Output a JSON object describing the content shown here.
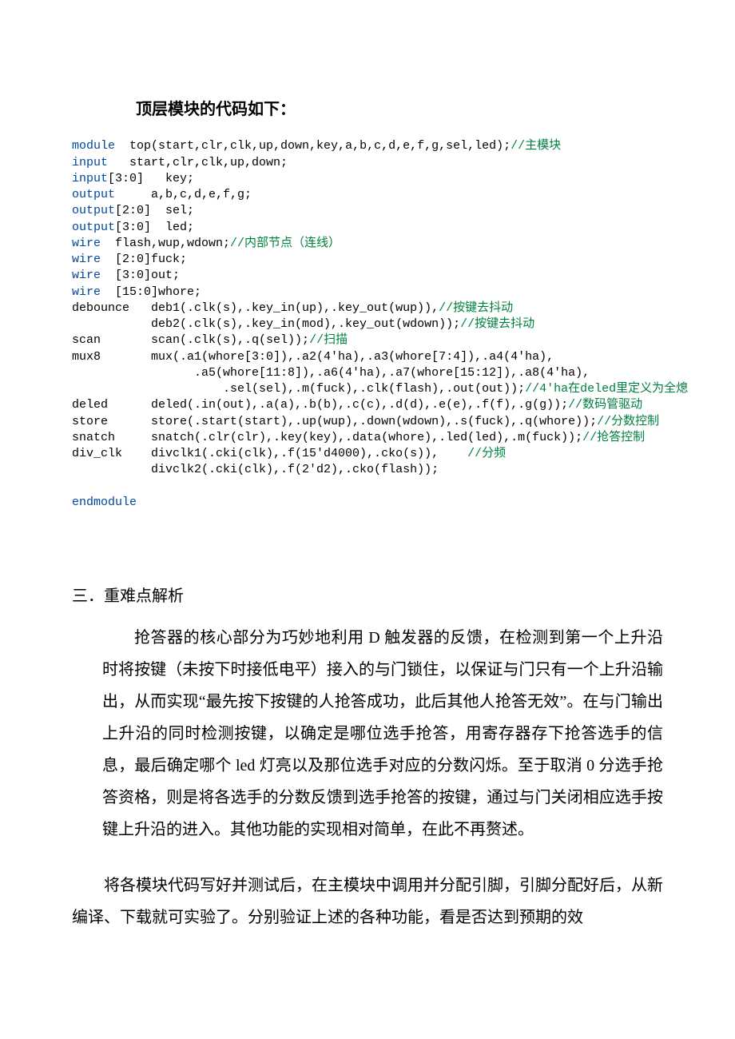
{
  "code_title": "顶层模块的代码如下：",
  "code": {
    "l1a": "module",
    "l1b": "  top(start,clr,clk,up,down,key,a,b,c,d,e,f,g,sel,led);",
    "l1c": "//主模块",
    "l2a": "input",
    "l2b": "   start,clr,clk,up,down;",
    "l3a": "input",
    "l3b": "[3:0]   key;",
    "l4a": "output",
    "l4b": "     a,b,c,d,e,f,g;",
    "l5a": "output",
    "l5b": "[2:0]  sel;",
    "l6a": "output",
    "l6b": "[3:0]  led;",
    "l7a": "wire",
    "l7b": "  flash,wup,wdown;",
    "l7c": "//内部节点（连线）",
    "l8a": "wire",
    "l8b": "  [2:0]fuck;",
    "l9a": "wire",
    "l9b": "  [3:0]out;",
    "l10a": "wire",
    "l10b": "  [15:0]whore;",
    "l11a": "debounce   deb1(.clk(s),.key_in(up),.key_out(wup)),",
    "l11c": "//按键去抖动",
    "l12a": "           deb2(.clk(s),.key_in(mod),.key_out(wdown));",
    "l12c": "//按键去抖动",
    "l13a": "scan       scan(.clk(s),.q(sel));",
    "l13c": "//扫描",
    "l14a": "mux8       mux(.a1(whore[3:0]),.a2(4'ha),.a3(whore[7:4]),.a4(4'ha),",
    "l15a": "                 .a5(whore[11:8]),.a6(4'ha),.a7(whore[15:12]),.a8(4'ha),",
    "l16a": "                     .sel(sel),.m(fuck),.clk(flash),.out(out));",
    "l16c": "//4'ha在deled里定义为全熄",
    "l17a": "deled      deled(.in(out),.a(a),.b(b),.c(c),.d(d),.e(e),.f(f),.g(g));",
    "l17c": "//数码管驱动",
    "l18a": "store      store(.start(start),.up(wup),.down(wdown),.s(fuck),.q(whore));",
    "l18c": "//分数控制",
    "l19a": "snatch     snatch(.clr(clr),.key(key),.data(whore),.led(led),.m(fuck));",
    "l19c": "//抢答控制",
    "l20a": "div_clk    divclk1(.cki(clk),.f(15'd4000),.cko(s)),    ",
    "l20c": "//分频",
    "l21a": "           divclk2(.cki(clk),.f(2'd2),.cko(flash));",
    "l22a": "endmodule"
  },
  "section_heading": "三．重难点解析",
  "para1": "抢答器的核心部分为巧妙地利用 D 触发器的反馈，在检测到第一个上升沿时将按键（未按下时接低电平）接入的与门锁住，以保证与门只有一个上升沿输出，从而实现“最先按下按键的人抢答成功，此后其他人抢答无效”。在与门输出上升沿的同时检测按键，以确定是哪位选手抢答，用寄存器存下抢答选手的信息，最后确定哪个 led 灯亮以及那位选手对应的分数闪烁。至于取消 0 分选手抢答资格，则是将各选手的分数反馈到选手抢答的按键，通过与门关闭相应选手按键上升沿的进入。其他功能的实现相对简单，在此不再赘述。",
  "para2": "将各模块代码写好并测试后，在主模块中调用并分配引脚，引脚分配好后，从新编译、下载就可实验了。分别验证上述的各种功能，看是否达到预期的效"
}
